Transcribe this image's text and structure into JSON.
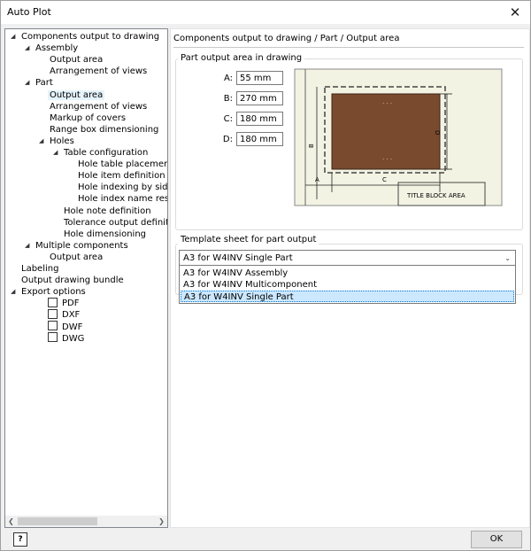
{
  "window": {
    "title": "Auto Plot",
    "close_glyph": "✕"
  },
  "tree": [
    {
      "label": "Components output to drawing",
      "level": 0,
      "expander": "expanded"
    },
    {
      "label": "Assembly",
      "level": 1,
      "expander": "expanded"
    },
    {
      "label": "Output area",
      "level": 2
    },
    {
      "label": "Arrangement of views",
      "level": 2
    },
    {
      "label": "Part",
      "level": 1,
      "expander": "expanded"
    },
    {
      "label": "Output area",
      "level": 2,
      "selected": true
    },
    {
      "label": "Arrangement of views",
      "level": 2
    },
    {
      "label": "Markup of covers",
      "level": 2
    },
    {
      "label": "Range box dimensioning",
      "level": 2
    },
    {
      "label": "Holes",
      "level": 2,
      "expander": "expanded"
    },
    {
      "label": "Table configuration",
      "level": 3,
      "expander": "expanded"
    },
    {
      "label": "Hole table placement",
      "level": 4
    },
    {
      "label": "Hole item definition",
      "level": 4
    },
    {
      "label": "Hole indexing by side a",
      "level": 4
    },
    {
      "label": "Hole index name reser",
      "level": 4
    },
    {
      "label": "Hole note definition",
      "level": 3
    },
    {
      "label": "Tolerance output definitio",
      "level": 3
    },
    {
      "label": "Hole dimensioning",
      "level": 3
    },
    {
      "label": "Multiple components",
      "level": 1,
      "expander": "expanded"
    },
    {
      "label": "Output area",
      "level": 2
    },
    {
      "label": "Labeling",
      "level": 0
    },
    {
      "label": "Output drawing bundle",
      "level": 0
    },
    {
      "label": "Export options",
      "level": 0,
      "expander": "expanded"
    },
    {
      "label": "PDF",
      "level": 2,
      "checkbox": true,
      "checked": false
    },
    {
      "label": "DXF",
      "level": 2,
      "checkbox": true,
      "checked": false
    },
    {
      "label": "DWF",
      "level": 2,
      "checkbox": true,
      "checked": false
    },
    {
      "label": "DWG",
      "level": 2,
      "checkbox": true,
      "checked": false
    }
  ],
  "breadcrumb": "Components output to drawing / Part / Output area",
  "output_area": {
    "group_title": "Part output  area in drawing",
    "fields": [
      {
        "label": "A:",
        "value": "55 mm"
      },
      {
        "label": "B:",
        "value": "270 mm"
      },
      {
        "label": "C:",
        "value": "180 mm"
      },
      {
        "label": "D:",
        "value": "180 mm"
      }
    ],
    "diagram": {
      "dim_a": "A",
      "dim_b": "B",
      "dim_c": "C",
      "dim_d": "D",
      "title_block": "TITLE BLOCK AREA",
      "part_color": "#7a4a2e"
    }
  },
  "template": {
    "group_title": "Template sheet for part output",
    "selected": "A3 for W4INV Single Part",
    "options": [
      "A3 for W4INV Assembly",
      "A3 for W4INV Multicomponent",
      "A3 for W4INV Single Part"
    ],
    "highlighted_index": 2
  },
  "footer": {
    "help_glyph": "?",
    "ok_label": "OK"
  }
}
